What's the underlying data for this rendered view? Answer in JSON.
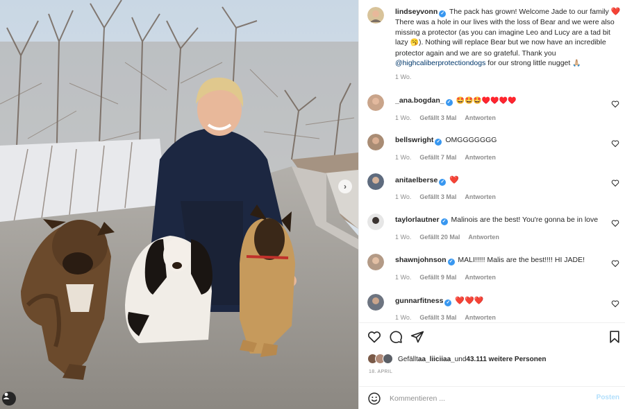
{
  "post": {
    "author": "lindseyvonn",
    "caption_parts": {
      "p1": "The pack has grown! Welcome Jade to our family ",
      "heart": "❤️",
      "p2": " There was a hole in our lives with the loss of Bear and we were also missing a protector (as you can imagine Leo and Lucy are a tad bit lazy ",
      "emoji_lazy": "🥱",
      "p3": "). Nothing will replace Bear but we now have an incredible protector again and we are so grateful. Thank you ",
      "mention": "@highcaliberprotectiondogs",
      "p4": " for our strong little nugget ",
      "emoji_pray": "🙏🏼"
    },
    "age": "1 Wo."
  },
  "comments": [
    {
      "user": "_ana.bogdan_",
      "verified": true,
      "text": "🤩🤩🤩♥️♥️♥️♥️",
      "age": "1 Wo.",
      "likes": "Gefällt 3 Mal",
      "reply": "Antworten"
    },
    {
      "user": "bellswright",
      "verified": true,
      "text": "OMGGGGGGG",
      "age": "1 Wo.",
      "likes": "Gefällt 7 Mal",
      "reply": "Antworten"
    },
    {
      "user": "anitaelberse",
      "verified": true,
      "text": "❤️",
      "age": "1 Wo.",
      "likes": "Gefällt 3 Mal",
      "reply": "Antworten"
    },
    {
      "user": "taylorlautner",
      "verified": true,
      "text": "Malinois are the best! You're gonna be in love",
      "age": "1 Wo.",
      "likes": "Gefällt 20 Mal",
      "reply": "Antworten"
    },
    {
      "user": "shawnjohnson",
      "verified": true,
      "text": "MALI!!!!! Malis are the best!!!! HI JADE!",
      "age": "1 Wo.",
      "likes": "Gefällt 9 Mal",
      "reply": "Antworten"
    },
    {
      "user": "gunnarfitness",
      "verified": true,
      "text": "❤️❤️❤️",
      "age": "1 Wo.",
      "likes": "Gefällt 3 Mal",
      "reply": "Antworten"
    }
  ],
  "likes": {
    "prefix": "Gefällt ",
    "user": "aa_liiciiaa_",
    "mid": " und ",
    "count": "43.111 weitere Personen"
  },
  "date": "18. APRIL",
  "add_comment": {
    "placeholder": "Kommentieren ...",
    "post_label": "Posten"
  },
  "icons": {
    "like": "heart-icon",
    "comment": "comment-icon",
    "share": "paper-plane-icon",
    "save": "bookmark-icon",
    "emoji": "smiley-icon",
    "next": "chevron-right-icon",
    "tag": "user-tag-icon",
    "verified": "verified-badge-icon"
  },
  "colors": {
    "link": "#00376b",
    "verified": "#3897f0",
    "muted": "#8e8e8e",
    "post_button": "#b2dffc"
  }
}
